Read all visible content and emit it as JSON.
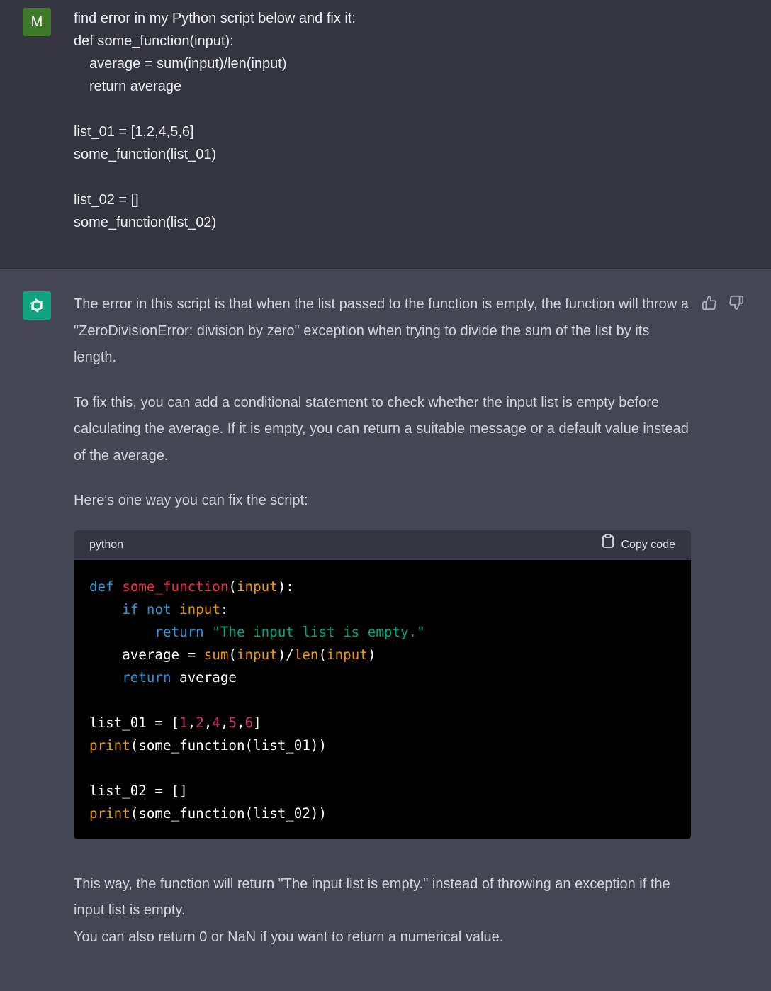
{
  "user": {
    "avatar_letter": "M",
    "lines": [
      "find error in my Python script below and fix it:",
      "def some_function(input):",
      "    average = sum(input)/len(input)",
      "    return average",
      "",
      "list_01 = [1,2,4,5,6]",
      "some_function(list_01)",
      "",
      "list_02 = []",
      "some_function(list_02)"
    ]
  },
  "assistant": {
    "intro_paragraphs": [
      "The error in this script is that when the list passed to the function is empty, the function will throw a \"ZeroDivisionError: division by zero\" exception when trying to divide the sum of the list by its length.",
      "To fix this, you can add a conditional statement to check whether the input list is empty before calculating the average. If it is empty, you can return a suitable message or a default value instead of the average.",
      "Here's one way you can fix the script:"
    ],
    "code": {
      "language": "python",
      "copy_label": "Copy code"
    },
    "outro_line1": "This way, the function will return \"The input list is empty.\" instead of throwing an exception if the input list is empty.",
    "outro_line2": "You can also return 0 or NaN if you want to return a numerical value."
  },
  "icons": {
    "user_avatar": "user-avatar",
    "bot_avatar": "openai-logo-icon",
    "thumbs_up": "thumbs-up-icon",
    "thumbs_down": "thumbs-down-icon",
    "clipboard": "clipboard-icon"
  },
  "colors": {
    "user_bg": "#343541",
    "assistant_bg": "#444654",
    "bot_avatar_bg": "#10a37f",
    "user_avatar_bg": "#3f7a2a"
  }
}
